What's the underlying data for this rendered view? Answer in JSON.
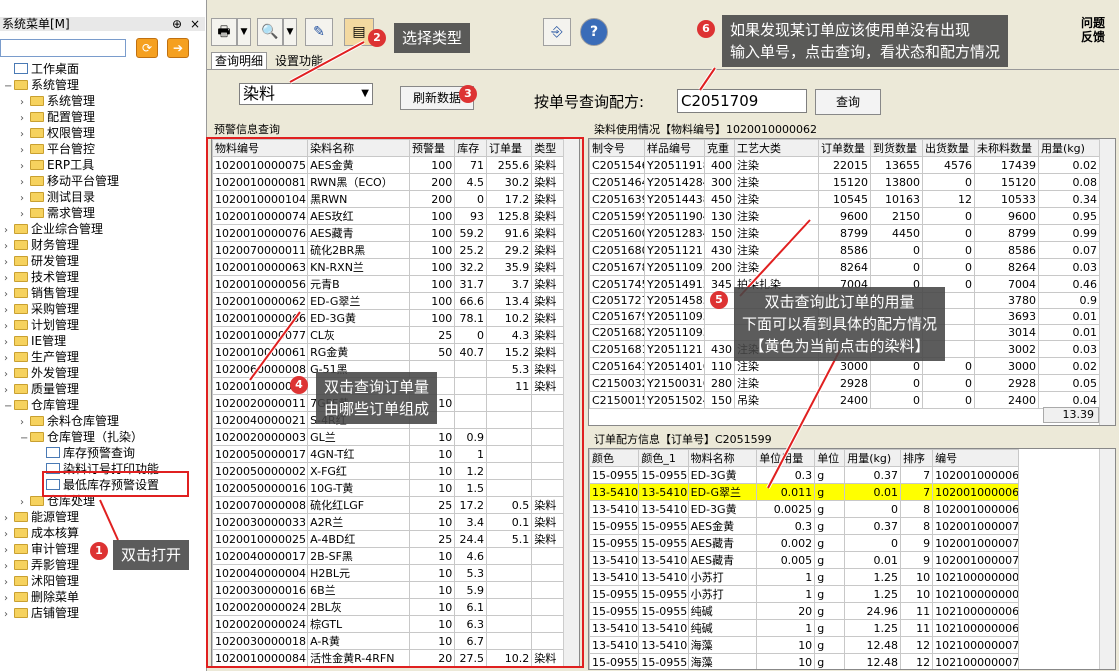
{
  "left": {
    "title": "系统菜单[M]",
    "pin": "⊕",
    "close": "×",
    "items": [
      {
        "label": "工作桌面",
        "type": "doc",
        "level": 0
      },
      {
        "label": "系统管理",
        "type": "folder",
        "level": 0,
        "exp": "−"
      },
      {
        "label": "系统管理",
        "type": "folder",
        "level": 1
      },
      {
        "label": "配置管理",
        "type": "folder",
        "level": 1
      },
      {
        "label": "权限管理",
        "type": "folder",
        "level": 1
      },
      {
        "label": "平台管控",
        "type": "folder",
        "level": 1
      },
      {
        "label": "ERP工具",
        "type": "folder",
        "level": 1
      },
      {
        "label": "移动平台管理",
        "type": "folder",
        "level": 1
      },
      {
        "label": "测试目录",
        "type": "folder",
        "level": 1
      },
      {
        "label": "需求管理",
        "type": "folder",
        "level": 1
      },
      {
        "label": "企业综合管理",
        "type": "folder",
        "level": 0
      },
      {
        "label": "财务管理",
        "type": "folder",
        "level": 0
      },
      {
        "label": "研发管理",
        "type": "folder",
        "level": 0
      },
      {
        "label": "技术管理",
        "type": "folder",
        "level": 0
      },
      {
        "label": "销售管理",
        "type": "folder",
        "level": 0
      },
      {
        "label": "采购管理",
        "type": "folder",
        "level": 0
      },
      {
        "label": "计划管理",
        "type": "folder",
        "level": 0
      },
      {
        "label": "IE管理",
        "type": "folder",
        "level": 0
      },
      {
        "label": "生产管理",
        "type": "folder",
        "level": 0
      },
      {
        "label": "外发管理",
        "type": "folder",
        "level": 0
      },
      {
        "label": "质量管理",
        "type": "folder",
        "level": 0
      },
      {
        "label": "仓库管理",
        "type": "folder",
        "level": 0,
        "exp": "−"
      },
      {
        "label": "余料仓库管理",
        "type": "folder",
        "level": 1
      },
      {
        "label": "仓库管理（扎染）",
        "type": "folder",
        "level": 1,
        "exp": "−"
      },
      {
        "label": "库存预警查询",
        "type": "doc",
        "level": 2
      },
      {
        "label": "染料订号打印功能",
        "type": "doc",
        "level": 2
      },
      {
        "label": "最低库存预警设置",
        "type": "doc",
        "level": 2
      },
      {
        "label": "仓库处理",
        "type": "folder",
        "level": 1
      },
      {
        "label": "能源管理",
        "type": "folder",
        "level": 0
      },
      {
        "label": "成本核算",
        "type": "folder",
        "level": 0
      },
      {
        "label": "审计管理",
        "type": "folder",
        "level": 0
      },
      {
        "label": "弄影管理",
        "type": "folder",
        "level": 0
      },
      {
        "label": "沭阳管理",
        "type": "folder",
        "level": 0
      },
      {
        "label": "删除菜单",
        "type": "folder",
        "level": 0
      },
      {
        "label": "店铺管理",
        "type": "folder",
        "level": 0
      }
    ]
  },
  "toolbar": {
    "help_text": "问题\n反馈"
  },
  "tabs": [
    "查询明细",
    "设置功能"
  ],
  "filter": {
    "type_value": "染料",
    "refresh": "刷新数据",
    "query_label": "按单号查询配方:",
    "order_value": "C2051709",
    "query_btn": "查询"
  },
  "warn": {
    "title": "预警信息查询",
    "cols": [
      "物料编号",
      "染料名称",
      "预警量",
      "库存",
      "订单量",
      "类型"
    ],
    "rows": [
      [
        "1020010000075",
        "AES金黄",
        "100",
        "71",
        "255.6",
        "染料"
      ],
      [
        "1020010000081",
        "RWN黑（ECO）",
        "200",
        "4.5",
        "30.2",
        "染料"
      ],
      [
        "1020010000104",
        "黑RWN",
        "200",
        "0",
        "17.2",
        "染料"
      ],
      [
        "1020010000074",
        "AES玫红",
        "100",
        "93",
        "125.8",
        "染料"
      ],
      [
        "1020010000076",
        "AES藏青",
        "100",
        "59.2",
        "91.6",
        "染料"
      ],
      [
        "1020070000011",
        "硫化2BR黑",
        "100",
        "25.2",
        "29.2",
        "染料"
      ],
      [
        "1020010000063",
        "KN-RXN兰",
        "100",
        "32.2",
        "35.9",
        "染料"
      ],
      [
        "1020010000056",
        "元青B",
        "100",
        "31.7",
        "3.7",
        "染料"
      ],
      [
        "1020010000062",
        "ED-G翠兰",
        "100",
        "66.6",
        "13.4",
        "染料"
      ],
      [
        "1020010000066",
        "ED-3G黄",
        "100",
        "78.1",
        "10.2",
        "染料"
      ],
      [
        "1020010000077",
        "CL灰",
        "25",
        "0",
        "4.3",
        "染料"
      ],
      [
        "1020010000061",
        "RG金黄",
        "50",
        "40.7",
        "15.2",
        "染料"
      ],
      [
        "1020060000008",
        "G-51黑",
        "",
        "",
        "5.3",
        "染料"
      ],
      [
        "1020010000082",
        "",
        "",
        "",
        "11",
        "染料"
      ],
      [
        "1020020000011",
        "7GFF黄",
        "10",
        "",
        "",
        ""
      ],
      [
        "1020040000021",
        "S-4R红",
        "",
        "",
        "",
        ""
      ],
      [
        "1020020000003",
        "GL兰",
        "10",
        "0.9",
        "",
        ""
      ],
      [
        "1020050000017",
        "4GN-T红",
        "10",
        "1",
        "",
        ""
      ],
      [
        "1020050000002",
        "X-FG红",
        "10",
        "1.2",
        "",
        ""
      ],
      [
        "1020050000016",
        "10G-T黄",
        "10",
        "1.5",
        "",
        ""
      ],
      [
        "1020070000008",
        "硫化红LGF",
        "25",
        "17.2",
        "0.5",
        "染料"
      ],
      [
        "1020030000033",
        "A2R兰",
        "10",
        "3.4",
        "0.1",
        "染料"
      ],
      [
        "1020010000025",
        "A-4BD红",
        "25",
        "24.4",
        "5.1",
        "染料"
      ],
      [
        "1020040000017",
        "2B-SF黑",
        "10",
        "4.6",
        "",
        ""
      ],
      [
        "1020040000004",
        "H2BL元",
        "10",
        "5.3",
        "",
        ""
      ],
      [
        "1020030000016",
        "6B兰",
        "10",
        "5.9",
        "",
        ""
      ],
      [
        "1020020000024",
        "2BL灰",
        "10",
        "6.1",
        "",
        ""
      ],
      [
        "1020020000024",
        "棕GTL",
        "10",
        "6.3",
        "",
        ""
      ],
      [
        "1020030000018",
        "A-R黄",
        "10",
        "6.7",
        "",
        ""
      ],
      [
        "1020010000084",
        "活性金黄R-4RFN",
        "20",
        "27.5",
        "10.2",
        "染料"
      ]
    ]
  },
  "usage": {
    "title": "染料使用情况【物料编号】1020010000062",
    "cols": [
      "制令号",
      "样品编号",
      "克重",
      "工艺大类",
      "订单数量",
      "到货数量",
      "出货数量",
      "未称料数量",
      "用量(kg)"
    ],
    "rows": [
      [
        "C2051546",
        "Y20511918",
        "400",
        "注染",
        "22015",
        "13655",
        "4576",
        "17439",
        "0.02"
      ],
      [
        "C2051464",
        "Y20514284",
        "300",
        "注染",
        "15120",
        "13800",
        "0",
        "15120",
        "0.08"
      ],
      [
        "C2051639",
        "Y20514438",
        "450",
        "注染",
        "10545",
        "10163",
        "12",
        "10533",
        "0.34"
      ],
      [
        "C2051599",
        "Y20511904",
        "130",
        "注染",
        "9600",
        "2150",
        "0",
        "9600",
        "0.95"
      ],
      [
        "C2051600",
        "Y20512834",
        "150",
        "注染",
        "8799",
        "4450",
        "0",
        "8799",
        "0.99"
      ],
      [
        "C2051680",
        "Y20511211",
        "430",
        "注染",
        "8586",
        "0",
        "0",
        "8586",
        "0.07"
      ],
      [
        "C2051678",
        "Y20511093",
        "200",
        "注染",
        "8264",
        "0",
        "0",
        "8264",
        "0.03"
      ],
      [
        "C2051745",
        "Y20514915",
        "345",
        "拍染扎染",
        "7004",
        "0",
        "0",
        "7004",
        "0.46"
      ],
      [
        "C2051727",
        "Y20514585",
        "",
        "",
        "",
        "",
        "",
        "3780",
        "0.9"
      ],
      [
        "C2051679",
        "Y20511093",
        "",
        "",
        "",
        "",
        "",
        "3693",
        "0.01"
      ],
      [
        "C2051682",
        "Y20511093",
        "",
        "",
        "",
        "",
        "",
        "3014",
        "0.01"
      ],
      [
        "C2051681",
        "Y20511211",
        "430",
        "注染",
        "",
        "",
        "",
        "3002",
        "0.03"
      ],
      [
        "C2051643",
        "Y20514016",
        "110",
        "注染",
        "3000",
        "0",
        "0",
        "3000",
        "0.02"
      ],
      [
        "C2150032",
        "Y21500316",
        "280",
        "注染",
        "2928",
        "0",
        "0",
        "2928",
        "0.05"
      ],
      [
        "C2150015",
        "Y20515024",
        "150",
        "吊染",
        "2400",
        "0",
        "0",
        "2400",
        "0.04"
      ]
    ],
    "total": "13.39"
  },
  "recipe": {
    "title": "订单配方信息【订单号】C2051599",
    "cols": [
      "颜色",
      "颜色_1",
      "物料名称",
      "单位用量",
      "单位",
      "用量(kg)",
      "排序",
      "编号"
    ],
    "highlight": 1,
    "rows": [
      [
        "15-0955",
        "15-0955",
        "ED-3G黄",
        "0.3",
        "g",
        "0.37",
        "7",
        "1020010000066"
      ],
      [
        "13-5410",
        "13-5410",
        "ED-G翠兰",
        "0.011",
        "g",
        "0.01",
        "7",
        "1020010000062"
      ],
      [
        "13-5410",
        "13-5410",
        "ED-3G黄",
        "0.0025",
        "g",
        "0",
        "8",
        "1020010000066"
      ],
      [
        "15-0955",
        "15-0955",
        "AES金黄",
        "0.3",
        "g",
        "0.37",
        "8",
        "1020010000075"
      ],
      [
        "15-0955",
        "15-0955",
        "AES藏青",
        "0.002",
        "g",
        "0",
        "9",
        "1020010000076"
      ],
      [
        "13-5410",
        "13-5410",
        "AES藏青",
        "0.005",
        "g",
        "0.01",
        "9",
        "1020010000076"
      ],
      [
        "13-5410",
        "13-5410",
        "小苏打",
        "1",
        "g",
        "1.25",
        "10",
        "1021000000002"
      ],
      [
        "15-0955",
        "15-0955",
        "小苏打",
        "1",
        "g",
        "1.25",
        "10",
        "1021000000002"
      ],
      [
        "15-0955",
        "15-0955",
        "纯碱",
        "20",
        "g",
        "24.96",
        "11",
        "1021000000067"
      ],
      [
        "13-5410",
        "13-5410",
        "纯碱",
        "1",
        "g",
        "1.25",
        "11",
        "1021000000067"
      ],
      [
        "13-5410",
        "13-5410",
        "海藻",
        "10",
        "g",
        "12.48",
        "12",
        "1021000000079"
      ],
      [
        "15-0955",
        "15-0955",
        "海藻",
        "10",
        "g",
        "12.48",
        "12",
        "1021000000079"
      ]
    ]
  },
  "callouts": {
    "c1": "双击打开",
    "c2": "选择类型",
    "c3": "3",
    "c4": "双击查询订单量\n由哪些订单组成",
    "c5": "双击查询此订单的用量\n下面可以看到具体的配方情况\n【黄色为当前点击的染料】",
    "c6": "如果发现某订单应该使用单没有出现\n输入单号，点击查询，看状态和配方情况",
    "n1": "1",
    "n2": "2",
    "n4": "4",
    "n5": "5",
    "n6": "6"
  }
}
